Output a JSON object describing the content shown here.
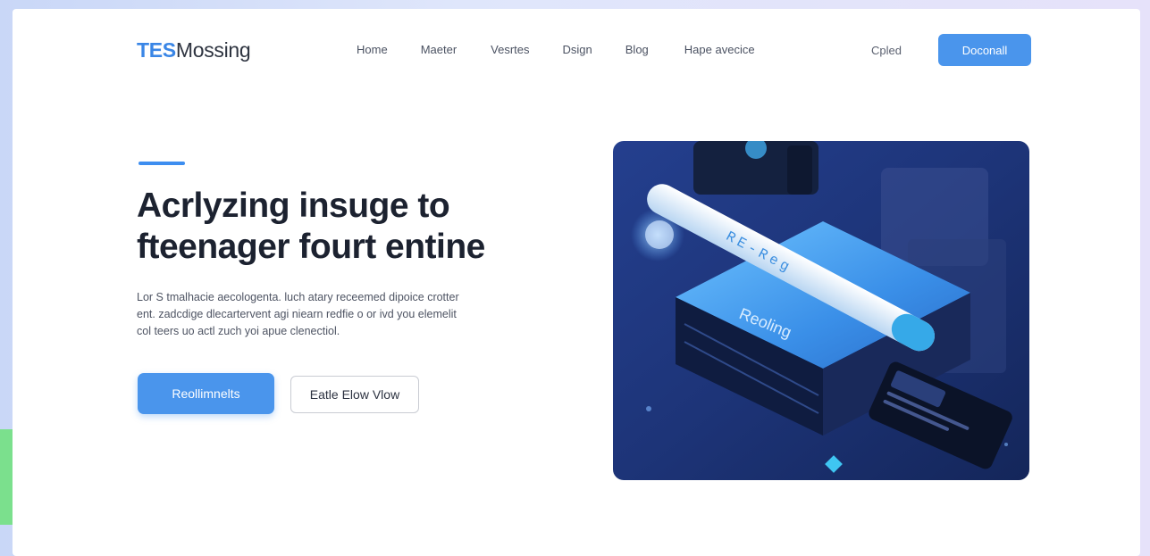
{
  "header": {
    "logo_accent": "TES",
    "logo_rest": "Mossing",
    "nav": [
      "Home",
      "Maeter",
      "Vesrtes",
      "Dsign",
      "Blog",
      "Hape avecice"
    ],
    "login": "Cpled",
    "cta": "Doconall"
  },
  "hero": {
    "title_lines": [
      "Acrlyzing insuge to",
      "fteenager fourt entine"
    ],
    "description_lines": [
      "Lor S tmalhacie aecologenta. luch atary receemed dipoice crotter",
      "ent. zadcdige dlecartervent agi niearn redfie o or ivd you elemelit",
      "col teers uo actl zuch yoi apue clenectiol."
    ],
    "primary_button": "Reollimnelts",
    "secondary_button": "Eatle Elow Vlow",
    "illustration_text": "Reoling",
    "illustration_pen_text": "RE-Reg"
  },
  "colors": {
    "accent": "#4a95ec",
    "heading": "#1c2230",
    "illustration_bg": "#1e3a85"
  }
}
